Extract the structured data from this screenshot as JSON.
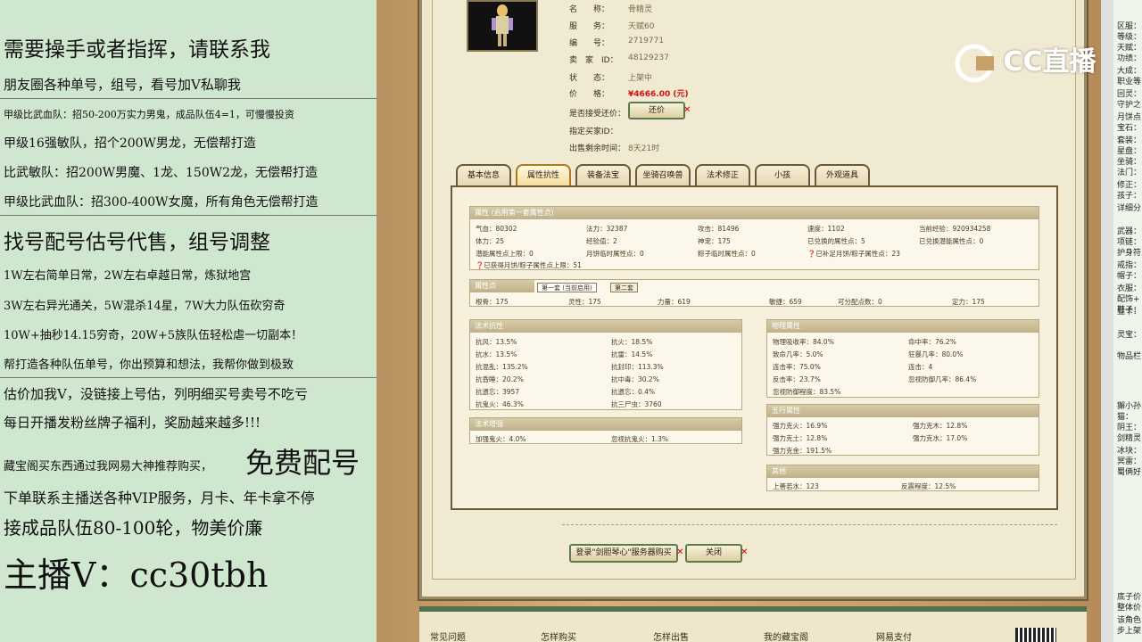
{
  "promo": {
    "lines": [
      "需要操手或者指挥，请联系我",
      "朋友圈各种单号，组号，看号加V私聊我",
      "甲级比武血队：招50-200万实力男鬼，成品队伍4=1，可慢慢投资",
      "甲级16强敏队，招个200W男龙，无偿帮打造",
      "比武敏队：招200W男魔、1龙、150W2龙，无偿帮打造",
      "甲级比武血队：招300-400W女魔，所有角色无偿帮打造",
      "找号配号估号代售，组号调整",
      "1W左右简单日常，2W左右卓越日常，炼狱地宫",
      "3W左右异光通关，5W混杀14星，7W大力队伍砍穷奇",
      "10W+抽秒14.15穷奇，20W+5族队伍轻松虐一切副本！",
      "帮打造各种队伍单号，你出预算和想法，我帮你做到极致",
      "估价加我V，没链接上号估，列明细买号卖号不吃亏",
      "每日开播发粉丝牌子福利，奖励越来越多!!!",
      "藏宝阁买东西通过我网易大神推荐购买，",
      "免费配号",
      "下单联系主播送各种VIP服务，月卡、年卡拿不停",
      "接成品队伍80-100轮，物美价廉",
      "主播V：cc30tbh"
    ]
  },
  "watermark": "CC直播",
  "info": {
    "name_label": "名　　称：",
    "name": "骨精灵",
    "server_label": "服　　务：",
    "server": "天赋60",
    "id_label": "编　　号：",
    "id": "2719771",
    "seller_label": "卖　家　ID：",
    "seller": "48129237",
    "status_label": "状　　态：",
    "status": "上架中",
    "price_label": "价　　格：",
    "price": "¥4666.00 (元)",
    "bargain_label": "是否接受还价：",
    "bargain_btn": "还价",
    "buyer_label": "指定买家ID：",
    "time_label": "出售剩余时间：",
    "time": "8天21时"
  },
  "tabs": [
    "基本信息",
    "属性抗性",
    "装备法宝",
    "坐骑召唤兽",
    "法术修正",
    "小孩",
    "外观道具"
  ],
  "attr": {
    "title": "属性 (启用第一套属性点)",
    "rows": [
      [
        "气血：80302",
        "法力：32387",
        "攻击：81496",
        "速度：1102",
        "当前经验：920934258"
      ],
      [
        "体力：25",
        "经验值：2",
        "神宠：175",
        "已兑换的属性点：5",
        "已兑换潜能属性点：0"
      ],
      [
        "潜能属性点上限：0",
        "月饼临时属性点：0",
        "粽子临时属性点：0",
        "已补足月饼/粽子属性点：23",
        ""
      ]
    ],
    "note": "已获得月饼/粽子属性点上限：51"
  },
  "points": {
    "title": "属性点",
    "tab1": "第一套 (当前启用)",
    "tab2": "第二套",
    "items": [
      "根骨：175",
      "灵性：175",
      "力量：619",
      "敏捷：659",
      "可分配点数：0",
      "定力：175"
    ]
  },
  "resist": {
    "title": "法术抗性",
    "rows": [
      [
        "抗风：13.5%",
        "抗火：18.5%"
      ],
      [
        "抗水：13.5%",
        "抗雷：14.5%"
      ],
      [
        "抗混乱：135.2%",
        "抗封印：113.3%"
      ],
      [
        "抗昏睡：20.2%",
        "抗中毒：30.2%"
      ],
      [
        "抗遗忘：3957",
        "抗遗忘：0.4%"
      ],
      [
        "抗鬼火：46.3%",
        "抗三尸虫：3760"
      ]
    ]
  },
  "boost": {
    "title": "法术增强",
    "items": [
      "加强鬼火：4.0%",
      "忽视抗鬼火：1.3%"
    ]
  },
  "phys": {
    "title": "物理属性",
    "rows": [
      [
        "物理吸收率：84.0%",
        "命中率：76.2%"
      ],
      [
        "致命几率：5.0%",
        "狂暴几率：80.0%"
      ],
      [
        "连击率：75.0%",
        "连击：4"
      ],
      [
        "反击率：23.7%",
        "忽视防御几率：86.4%"
      ],
      [
        "忽视防御程度：83.5%",
        ""
      ]
    ]
  },
  "five": {
    "title": "五行属性",
    "rows": [
      [
        "强力克火：16.9%",
        "强力克木：12.8%"
      ],
      [
        "强力克土：12.8%",
        "强力克水：17.0%"
      ],
      [
        "强力克金：191.5%",
        ""
      ]
    ]
  },
  "other": {
    "title": "其他",
    "items": [
      "上善若水：123",
      "反震程度：12.5%"
    ]
  },
  "actions": {
    "login_buy": "登录\"剑胆琴心\"服务器购买",
    "close": "关闭"
  },
  "footer": [
    "常见问题",
    "怎样购买",
    "怎样出售",
    "我的藏宝阁",
    "网易支付"
  ],
  "right_strip": [
    "区服：",
    "等级：",
    "天赋：",
    "功绩：",
    "大成：",
    "职业等",
    "回灵：",
    "守护之",
    "月饼点",
    "宝石：",
    "套装：",
    "星盘：",
    "坐骑：",
    "法门：",
    "修正：",
    "孩子：",
    "详细分",
    "武器：",
    "项链：",
    "护身符",
    "戒指：",
    "帽子：",
    "衣服：",
    "配饰+",
    "鞋子：",
    "显卡：",
    "灵宝：",
    "物品栏",
    "獬小孙",
    "猫：",
    "阴王：",
    "剑精灵",
    "冰块：",
    "冥雷：",
    "蜀俩好",
    "底子价",
    "整体价",
    "该角色",
    "步上架"
  ]
}
